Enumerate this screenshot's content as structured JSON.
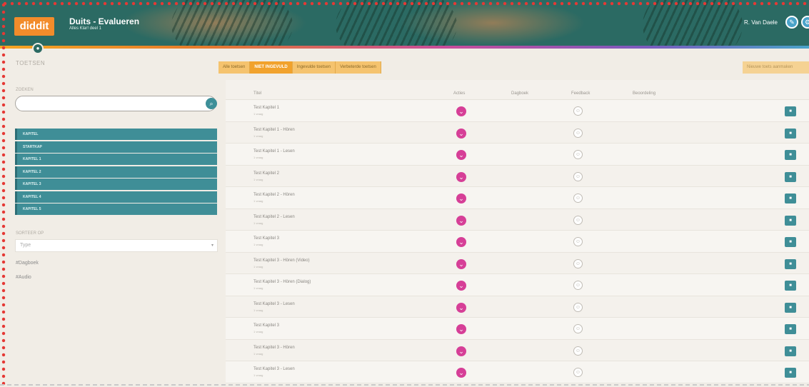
{
  "header": {
    "logo": "diddit",
    "title": "Duits - Evalueren",
    "subtitle": "Alles Klar! deel 1",
    "user": "R. Van Daele",
    "badge": "●"
  },
  "left": {
    "section_title": "TOETSEN",
    "search_label": "ZOEKEN",
    "search_icon": "⌕",
    "chapters": [
      "KAPITEL",
      "STARTKAP",
      "KAPITEL 1",
      "KAPITEL 2",
      "KAPITEL 3",
      "KAPITEL 4",
      "KAPITEL 5"
    ],
    "sort_label": "SORTEER OP",
    "sort_value": "Type",
    "filters": [
      "#Dagboek",
      "#Audio"
    ]
  },
  "tabs": [
    "Alle toetsen",
    "NIET INGEVULD",
    "Ingevulde toetsen",
    "Verbeterde toetsen"
  ],
  "right_button": "Nieuwe toets aanmaken",
  "table": {
    "columns": [
      "Titel",
      "Acties",
      "Dagboek",
      "Feedback",
      "Beoordeling"
    ],
    "rows": [
      {
        "title": "Test Kapitel 1",
        "sub": "1 vraag"
      },
      {
        "title": "Test Kapitel 1 - Hören",
        "sub": "1 vraag"
      },
      {
        "title": "Test Kapitel 1 - Lesen",
        "sub": "1 vraag"
      },
      {
        "title": "Test Kapitel 2",
        "sub": "1 vraag"
      },
      {
        "title": "Test Kapitel 2 - Hören",
        "sub": "1 vraag"
      },
      {
        "title": "Test Kapitel 2 - Lesen",
        "sub": "1 vraag"
      },
      {
        "title": "Test Kapitel 3",
        "sub": "1 vraag"
      },
      {
        "title": "Test Kapitel 3 - Hören (Video)",
        "sub": "1 vraag"
      },
      {
        "title": "Test Kapitel 3 - Hören (Dialog)",
        "sub": "1 vraag"
      },
      {
        "title": "Test Kapitel 3 - Lesen",
        "sub": "1 vraag"
      },
      {
        "title": "Test Kapitel 3",
        "sub": "1 vraag"
      },
      {
        "title": "Test Kapitel 3 - Hören",
        "sub": "1 vraag"
      },
      {
        "title": "Test Kapitel 3 - Lesen",
        "sub": "1 vraag"
      }
    ]
  },
  "icons": {
    "action": "chevron-down-icon",
    "status": "smiley-icon",
    "row_button": "square-icon"
  }
}
